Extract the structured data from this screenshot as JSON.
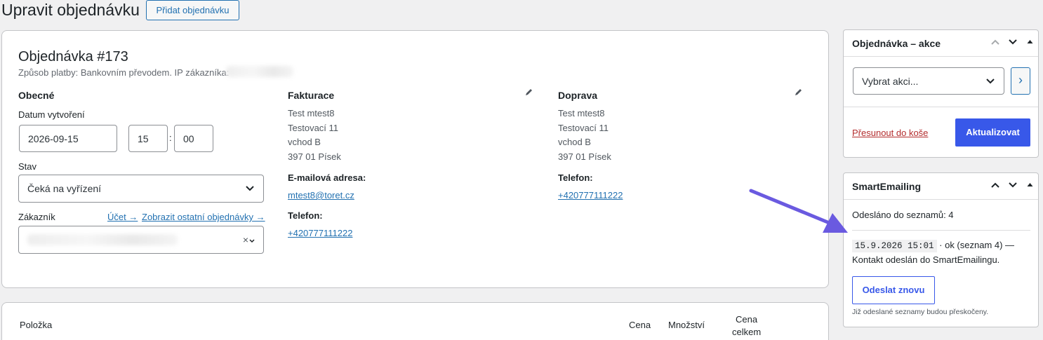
{
  "header": {
    "title": "Upravit objednávku",
    "add_order_label": "Přidat objednávku"
  },
  "order": {
    "title": "Objednávka #173",
    "meta": "Způsob platby: Bankovním převodem. IP zákazníka:",
    "general": {
      "heading": "Obecné",
      "date_label": "Datum vytvoření",
      "date_value": "2026-09-15",
      "hour_value": "15",
      "minute_value": "00",
      "time_sep": ":",
      "status_label": "Stav",
      "status_value": "Čeká na vyřízení",
      "customer_label": "Zákazník",
      "account_link": "Účet →",
      "other_orders_link": "Zobrazit ostatní objednávky →",
      "clear_symbol": "×"
    },
    "billing": {
      "heading": "Fakturace",
      "address": [
        "Test mtest8",
        "Testovací 11",
        "vchod B",
        "397 01 Písek"
      ],
      "email_label": "E-mailová adresa:",
      "email": "mtest8@toret.cz",
      "phone_label": "Telefon:",
      "phone": "+420777111222"
    },
    "shipping": {
      "heading": "Doprava",
      "address": [
        "Test mtest8",
        "Testovací 11",
        "vchod B",
        "397 01 Písek"
      ],
      "phone_label": "Telefon:",
      "phone": "+420777111222"
    }
  },
  "items": {
    "col_item": "Položka",
    "col_price": "Cena",
    "col_qty": "Množství",
    "col_total_1": "Cena",
    "col_total_2": "celkem"
  },
  "actions_box": {
    "title": "Objednávka – akce",
    "select_value": "Vybrat akci...",
    "go_symbol": "›",
    "trash_label": "Přesunout do koše",
    "update_label": "Aktualizovat"
  },
  "smartemailing": {
    "title": "SmartEmailing",
    "sent_to_lists": "Odesláno do seznamů: 4",
    "log_timestamp": "15.9.2026 15:01",
    "log_text_1": " · ok (seznam 4) —",
    "log_text_2": "Kontakt odeslán do SmartEmailingu.",
    "resend_label": "Odeslat znovu",
    "hint": "Již odeslané seznamy budou přeskočeny."
  },
  "colors": {
    "accent": "#3858e9",
    "link": "#2271b1",
    "arrow": "#6a5ae0",
    "danger": "#b32d2e"
  }
}
